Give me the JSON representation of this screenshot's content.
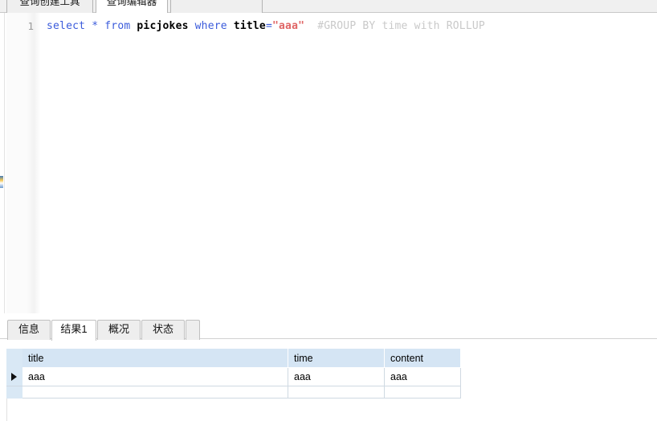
{
  "editor_tabs": [
    {
      "label": "查询创建工具",
      "active": false
    },
    {
      "label": "查询编辑器",
      "active": true
    },
    {
      "label": "",
      "active": false
    }
  ],
  "sql_editor": {
    "line_number": "1",
    "tokens": [
      {
        "text": "select",
        "type": "keyword"
      },
      {
        "text": " ",
        "type": "plain"
      },
      {
        "text": "*",
        "type": "operator"
      },
      {
        "text": " ",
        "type": "plain"
      },
      {
        "text": "from",
        "type": "keyword"
      },
      {
        "text": " ",
        "type": "plain"
      },
      {
        "text": "picjokes",
        "type": "identifier"
      },
      {
        "text": " ",
        "type": "plain"
      },
      {
        "text": "where",
        "type": "keyword"
      },
      {
        "text": " ",
        "type": "plain"
      },
      {
        "text": "title",
        "type": "identifier"
      },
      {
        "text": "=",
        "type": "operator"
      },
      {
        "text": "\"aaa\"",
        "type": "string"
      },
      {
        "text": "  ",
        "type": "plain"
      },
      {
        "text": "#GROUP BY time with ROLLUP",
        "type": "comment"
      }
    ],
    "full_text": "select * from picjokes where title=\"aaa\"  #GROUP BY time with ROLLUP"
  },
  "result_tabs": [
    {
      "label": "信息",
      "active": false
    },
    {
      "label": "结果1",
      "active": true
    },
    {
      "label": "概况",
      "active": false
    },
    {
      "label": "状态",
      "active": false
    },
    {
      "label": "",
      "active": false
    }
  ],
  "result_grid": {
    "columns": [
      "title",
      "time",
      "content"
    ],
    "rows": [
      {
        "selected": true,
        "cells": [
          "aaa",
          "aaa",
          "aaa"
        ]
      }
    ]
  },
  "colors": {
    "keyword": "#3b5bdb",
    "string": "#e06666",
    "comment": "#c9c9c9",
    "grid_header_bg": "#d5e5f4",
    "tab_active_bg": "#ffffff"
  }
}
